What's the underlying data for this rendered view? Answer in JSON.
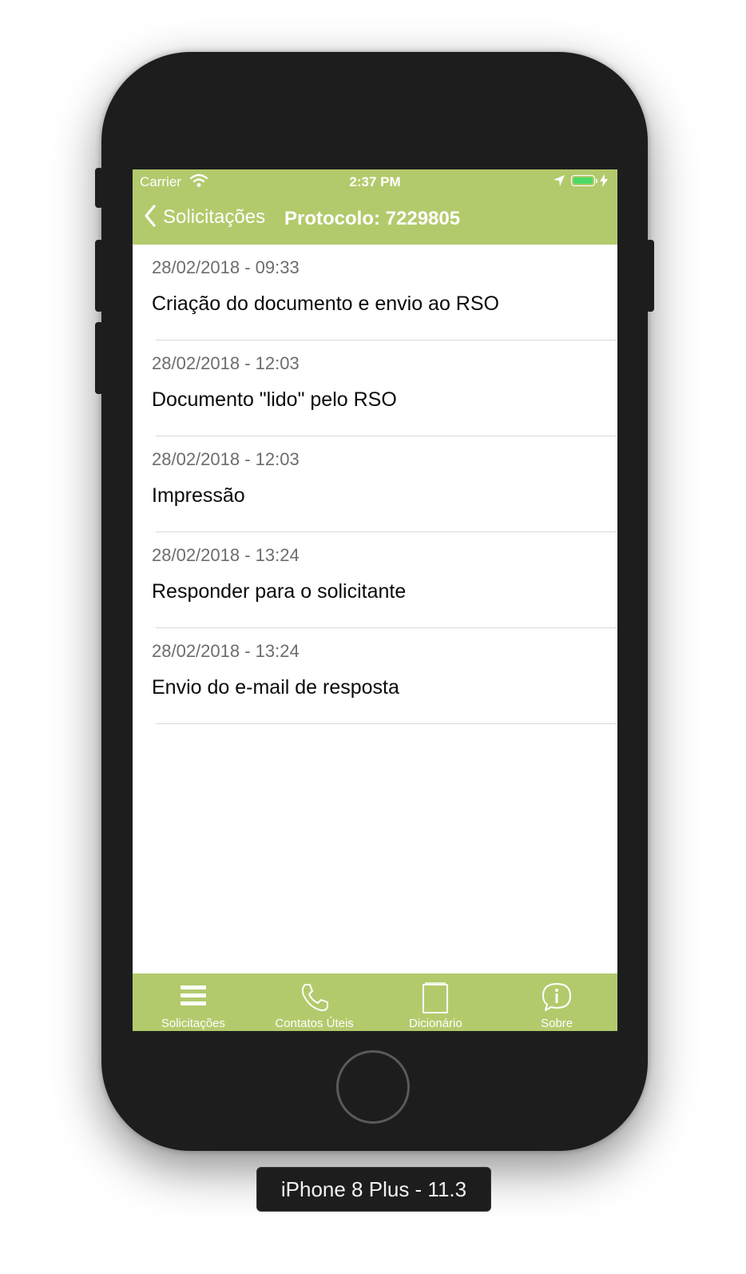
{
  "status_bar": {
    "carrier": "Carrier",
    "time": "2:37 PM"
  },
  "nav_bar": {
    "back_label": "Solicitações",
    "title": "Protocolo: 7229805"
  },
  "timeline": [
    {
      "date": "28/02/2018 - 09:33",
      "title": "Criação do documento e envio ao RSO"
    },
    {
      "date": "28/02/2018 - 12:03",
      "title": "Documento \"lido\" pelo RSO"
    },
    {
      "date": "28/02/2018 - 12:03",
      "title": "Impressão"
    },
    {
      "date": "28/02/2018 - 13:24",
      "title": "Responder para o solicitante"
    },
    {
      "date": "28/02/2018 - 13:24",
      "title": "Envio do e-mail de resposta"
    }
  ],
  "tab_bar": [
    {
      "label": "Solicitações",
      "icon": "list-icon"
    },
    {
      "label": "Contatos Úteis",
      "icon": "phone-icon"
    },
    {
      "label": "Dicionário",
      "icon": "book-icon"
    },
    {
      "label": "Sobre",
      "icon": "info-chat-icon"
    }
  ],
  "device_label": "iPhone 8 Plus - 11.3",
  "colors": {
    "accent": "#b3ca6c",
    "device": "#1d1d1d",
    "battery": "#4cd964"
  }
}
